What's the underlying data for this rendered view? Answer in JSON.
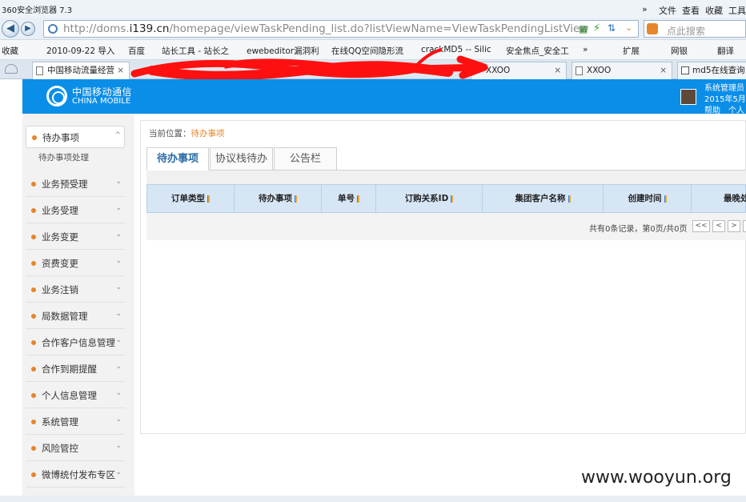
{
  "browser": {
    "app_title": "360安全浏览器 7.3",
    "menu": [
      "»",
      "文件",
      "查看",
      "收藏",
      "工具"
    ],
    "url_prefix": "http://doms.",
    "url_host": "i139.cn",
    "url_path": "/homepage/viewTaskPending_list.do?listViewName=ViewTaskPendingListView",
    "search_placeholder": "点此搜索",
    "favorites": [
      "收藏",
      "2010-09-22 导入",
      "百度",
      "站长工具 - 站长之",
      "ewebeditor漏洞利",
      "在线QQ空间隐形流",
      "crackMD5 -- Silic",
      "安全焦点_安全工",
      "»",
      "扩展",
      "网银",
      "翻译"
    ],
    "tabs": [
      "中国移动流量经营",
      "XXOO",
      "XXOO",
      "md5在线查询"
    ]
  },
  "header": {
    "logo_cn": "中国移动通信",
    "logo_en": "CHINA MOBILE",
    "user_role": "系统管理员",
    "date": "2015年5月",
    "help": "帮助",
    "personal": "个人"
  },
  "sidebar": {
    "items": [
      {
        "label": "待办事项",
        "chevron": "^"
      },
      {
        "label": "业务预受理",
        "chevron": "⌄"
      },
      {
        "label": "业务受理",
        "chevron": "⌄"
      },
      {
        "label": "业务变更",
        "chevron": "⌄"
      },
      {
        "label": "资费变更",
        "chevron": "⌄"
      },
      {
        "label": "业务注销",
        "chevron": "⌄"
      },
      {
        "label": "局数据管理",
        "chevron": "⌄"
      },
      {
        "label": "合作客户信息管理",
        "chevron": "⌄"
      },
      {
        "label": "合作到期提醒",
        "chevron": "⌄"
      },
      {
        "label": "个人信息管理",
        "chevron": "⌄"
      },
      {
        "label": "系统管理",
        "chevron": "⌄"
      },
      {
        "label": "风险管控",
        "chevron": "⌄"
      },
      {
        "label": "微博统付发布专区",
        "chevron": "⌄"
      }
    ],
    "sub_item": "待办事项处理"
  },
  "main": {
    "crumb_label": "当前位置：",
    "crumb_current": "待办事项",
    "tabs": [
      "待办事项",
      "协议栈待办",
      "公告栏"
    ],
    "columns": [
      "订单类型",
      "待办事项",
      "单号",
      "订购关系ID",
      "集团客户名称",
      "创建时间",
      "最晚处"
    ],
    "page_info": "共有0条记录，第0页/共0页",
    "pager": [
      "<<",
      "<",
      ">",
      ""
    ]
  },
  "watermark": "www.wooyun.org"
}
